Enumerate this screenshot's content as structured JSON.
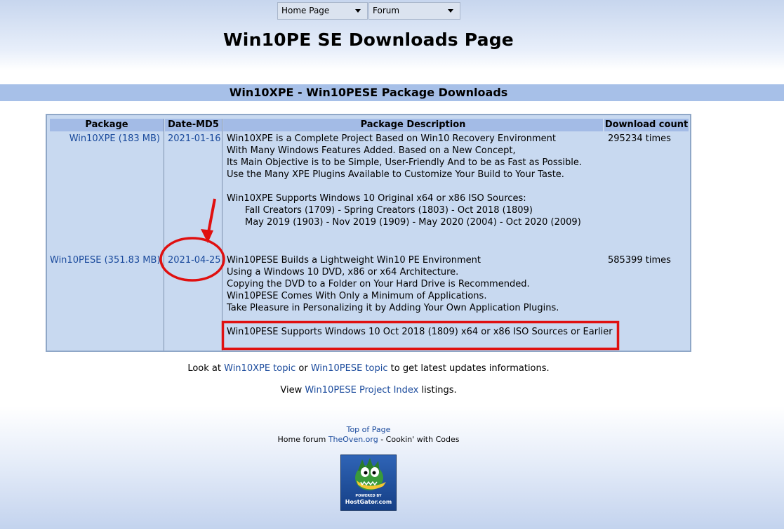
{
  "nav": {
    "home": "Home Page",
    "forum": "Forum"
  },
  "page_title": "Win10PE SE Downloads Page",
  "section_title": "Win10XPE - Win10PESE Package Downloads",
  "table": {
    "headers": [
      "Package",
      "Date-MD5",
      "Package Description",
      "Download count"
    ],
    "rows": [
      {
        "package": "Win10XPE (183 MB)",
        "date": "2021-01-16",
        "desc": [
          "Win10XPE is a Complete Project Based on Win10 Recovery Environment",
          "With Many Windows Features Added. Based on a New Concept,",
          "Its Main Objective is to be Simple, User-Friendly And to be as Fast as Possible.",
          "Use the Many XPE Plugins Available to Customize Your Build to Your Taste."
        ],
        "sources_title": "Win10XPE Supports Windows 10 Original x64 or x86 ISO Sources:",
        "sources": [
          "Fall Creators (1709) - Spring Creators (1803) - Oct 2018 (1809)",
          "May 2019 (1903) - Nov 2019 (1909) - May 2020 (2004) - Oct 2020 (2009)"
        ],
        "count": "295234 times"
      },
      {
        "package": "Win10PESE (351.83 MB)",
        "date": "2021-04-25",
        "desc": [
          "Win10PESE Builds a Lightweight Win10 PE Environment",
          "Using a Windows 10 DVD, x86 or x64 Architecture.",
          "Copying the DVD to a Folder on Your Hard Drive is Recommended.",
          "Win10PESE Comes With Only a Minimum of Applications.",
          "Take Pleasure in Personalizing it by Adding Your Own Application Plugins."
        ],
        "sources_title": "Win10PESE Supports Windows 10 Oct 2018 (1809) x64 or x86 ISO Sources or Earlier",
        "count": "585399 times"
      }
    ]
  },
  "footer_line1": {
    "prefix": "Look at",
    "link1": "Win10XPE topic",
    "mid": "or",
    "link2": "Win10PESE topic",
    "suffix": "to get latest updates informations."
  },
  "footer_line2": {
    "prefix": "View",
    "link": "Win10PESE Project Index",
    "suffix": "listings."
  },
  "bottom": {
    "top_link": "Top of Page",
    "home_prefix": "Home forum",
    "home_link": "TheOven.org",
    "home_suffix": "- Cookin' with Codes"
  },
  "logo": {
    "powered": "POWERED BY",
    "name": "HostGator.com"
  },
  "colors": {
    "section_bar": "#a7c0e8",
    "table_bg": "#c8d9f0",
    "header_bg": "#a3bbe6",
    "link": "#1a4a9c",
    "annotation": "#e01010"
  }
}
